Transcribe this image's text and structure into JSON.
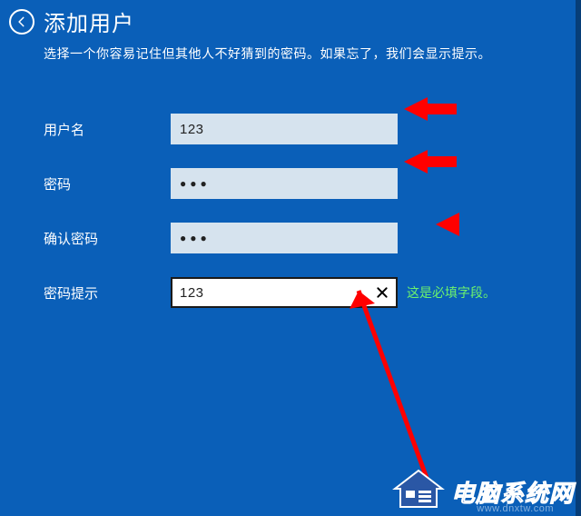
{
  "header": {
    "title": "添加用户",
    "subtitle": "选择一个你容易记住但其他人不好猜到的密码。如果忘了，我们会显示提示。"
  },
  "form": {
    "username": {
      "label": "用户名",
      "value": "123"
    },
    "password": {
      "label": "密码",
      "value": "●●●"
    },
    "confirm": {
      "label": "确认密码",
      "value": "●●●"
    },
    "hint": {
      "label": "密码提示",
      "value": "123",
      "error": "这是必填字段。"
    }
  },
  "watermark": {
    "text": "电脑系统网",
    "url": "www.dnxtw.com"
  },
  "colors": {
    "bg": "#0a5fb8",
    "input_bg": "#d6e3ee",
    "focus_bg": "#ffffff",
    "error": "#6df36d",
    "arrow": "#ff0000"
  }
}
